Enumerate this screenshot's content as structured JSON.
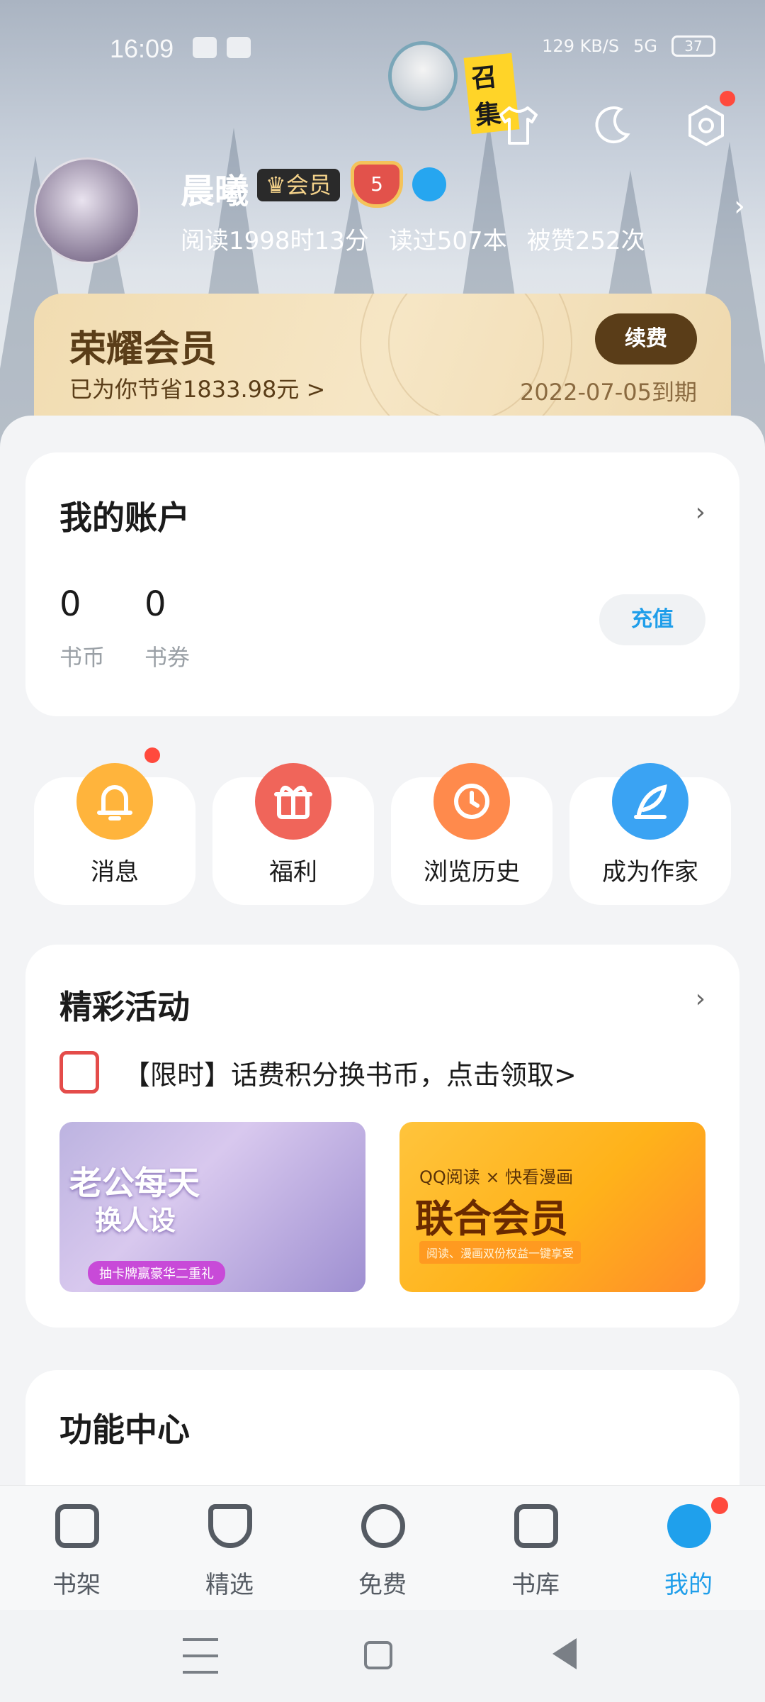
{
  "status_bar": {
    "time": "16:09",
    "speed": "129 KB/S",
    "battery": "37",
    "network": "5G"
  },
  "header": {
    "summon_text": "召集",
    "username": "晨曦",
    "vip_tag": "会员",
    "level": "5",
    "stats": [
      "阅读1998时13分",
      "读过507本",
      "被赞252次"
    ],
    "icons": [
      "shirt-icon",
      "moon-icon",
      "settings-icon"
    ]
  },
  "vip_card": {
    "title": "荣耀会员",
    "saved": "已为你节省1833.98元 >",
    "renew_label": "续费",
    "expiry": "2022-07-05到期"
  },
  "account": {
    "title": "我的账户",
    "coins_value": "0",
    "coins_label": "书币",
    "vouchers_value": "0",
    "vouchers_label": "书券",
    "recharge_label": "充值"
  },
  "quick_actions": [
    {
      "label": "消息",
      "icon": "bell-icon",
      "color": "#ffb43c"
    },
    {
      "label": "福利",
      "icon": "gift-icon",
      "color": "#f0655a"
    },
    {
      "label": "浏览历史",
      "icon": "clock-icon",
      "color": "#ff8a4c"
    },
    {
      "label": "成为作家",
      "icon": "feather-icon",
      "color": "#3aa3f3"
    }
  ],
  "events": {
    "title": "精彩活动",
    "promo_text": "【限时】话费积分换书币，点击领取>",
    "banner_a": {
      "title_line1": "老公每天",
      "title_line2": "换人设",
      "subtitle": "抽卡牌赢豪华二重礼"
    },
    "banner_b": {
      "top": "QQ阅读 × 快看漫画",
      "title": "联合会员",
      "subtitle": "阅读、漫画双份权益一键享受"
    }
  },
  "function_center": {
    "title": "功能中心"
  },
  "tabbar": [
    {
      "label": "书架",
      "icon": "bookshelf-icon",
      "active": false
    },
    {
      "label": "精选",
      "icon": "featured-icon",
      "active": false
    },
    {
      "label": "免费",
      "icon": "free-icon",
      "active": false
    },
    {
      "label": "书库",
      "icon": "library-icon",
      "active": false
    },
    {
      "label": "我的",
      "icon": "profile-icon",
      "active": true
    }
  ],
  "colors": {
    "accent": "#1f9eea",
    "vip_brown": "#5a3d18",
    "badge_red": "#ff4a3d"
  }
}
